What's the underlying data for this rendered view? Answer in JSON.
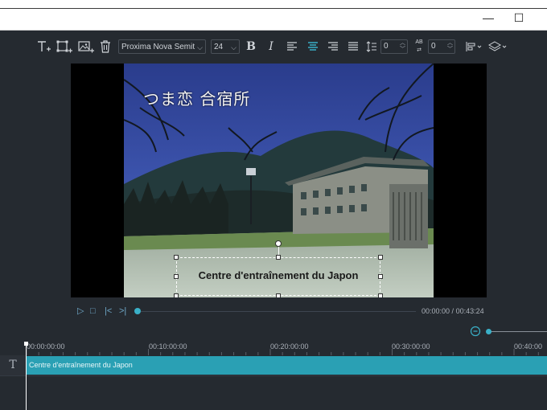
{
  "window": {
    "minimize_glyph": "—",
    "maximize_glyph": "☐"
  },
  "toolbar": {
    "icons": [
      "add-text-icon",
      "crop-icon",
      "add-image-icon",
      "trash-icon",
      "bold-icon",
      "italic-icon",
      "align-left-icon",
      "align-center-icon",
      "align-right-icon",
      "justify-icon",
      "line-spacing-icon",
      "char-spacing-icon",
      "arrange-icon",
      "layers-icon"
    ],
    "bold_label": "B",
    "italic_label": "I",
    "font_family": "Proxima Nova Semit",
    "font_size": "24",
    "line_spacing_value": "0",
    "char_spacing_value": "0",
    "char_spacing_glyph": "AB",
    "active_alignment": "center",
    "accent_color": "#3ab0c8"
  },
  "preview": {
    "video_overlay_text": "つま恋 合宿所",
    "caption_text": "Centre d'entraînement du Japon"
  },
  "playback": {
    "current_time": "00:00:00",
    "total_time": "00:43:24",
    "separator": " / "
  },
  "timeline": {
    "ruler_labels": [
      "00:00:00:00",
      "00:10:00:00",
      "00:20:00:00",
      "00:30:00:00",
      "00:40:00"
    ],
    "track_type_glyph": "T",
    "clip_label": "Centre d'entraînement du Japon",
    "clip_color": "#2aa0b4"
  }
}
